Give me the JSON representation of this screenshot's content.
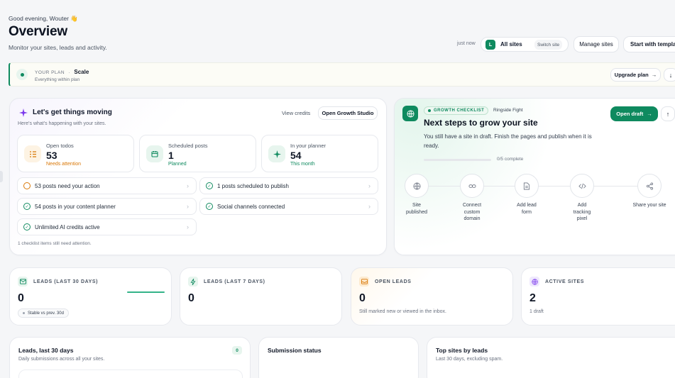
{
  "header": {
    "greeting": "Good evening, Wouter 👋",
    "title": "Overview",
    "subtitle": "Monitor your sites, leads and activity.",
    "updated": "just now",
    "site_avatar": "L",
    "site_label": "All sites",
    "switch_site": "Switch site",
    "manage_sites": "Manage sites",
    "start_template": "Start with template"
  },
  "plan": {
    "label": "YOUR PLAN",
    "separator": "·",
    "name": "Scale",
    "desc": "Everything within plan",
    "upgrade": "Upgrade plan",
    "upgrade_arrow": "→",
    "download_arrow": "↓"
  },
  "moving": {
    "title": "Let's get things moving",
    "subtitle": "Here's what's happening with your sites.",
    "view_credits": "View credits",
    "open_studio": "Open Growth Studio",
    "stats": [
      {
        "label": "Open todos",
        "value": "53",
        "sub": "Needs attention",
        "sub_color": "#d97706"
      },
      {
        "label": "Scheduled posts",
        "value": "1",
        "sub": "Planned",
        "sub_color": "#0f8a5f"
      },
      {
        "label": "In your planner",
        "value": "54",
        "sub": "This month",
        "sub_color": "#0f8a5f"
      }
    ],
    "items": [
      {
        "text": "53 posts need your action",
        "state": "warn"
      },
      {
        "text": "1 posts scheduled to publish",
        "state": "ok"
      },
      {
        "text": "54 posts in your content planner",
        "state": "ok"
      },
      {
        "text": "Social channels connected",
        "state": "ok"
      },
      {
        "text": "Unlimited AI credits active",
        "state": "ok"
      }
    ],
    "footnote": "1 checklist items still need attention.",
    "chevron": "›"
  },
  "growth": {
    "badge": "GROWTH CHECKLIST",
    "site_name": "Ringside Fight",
    "title": "Next steps to grow your site",
    "desc": "You still have a site in draft. Finish the pages and publish when it is ready.",
    "progress_text": "0/5 complete",
    "progress": 0,
    "open_draft": "Open draft",
    "open_arrow": "→",
    "up_arrow": "↑",
    "steps": [
      {
        "label": "Site published",
        "icon": "globe-icon"
      },
      {
        "label": "Connect custom domain",
        "icon": "link-icon"
      },
      {
        "label": "Add lead form",
        "icon": "document-icon"
      },
      {
        "label": "Add tracking pixel",
        "icon": "code-icon"
      },
      {
        "label": "Share your site",
        "icon": "share-icon"
      }
    ]
  },
  "kpis": [
    {
      "label": "LEADS (LAST 30 DAYS)",
      "value": "0",
      "badge": "Stable vs prev. 30d",
      "color": "#0f8a5f"
    },
    {
      "label": "LEADS (LAST 7 DAYS)",
      "value": "0",
      "color": "#0f8a5f"
    },
    {
      "label": "OPEN LEADS",
      "value": "0",
      "sub": "Still marked new or viewed in the inbox.",
      "color": "#d97706"
    },
    {
      "label": "ACTIVE SITES",
      "value": "2",
      "sub": "1 draft",
      "color": "#7c3aed"
    }
  ],
  "bottom": {
    "leads_title": "Leads, last 30 days",
    "leads_sub": "Daily submissions across all your sites.",
    "leads_count": "0",
    "submission_title": "Submission status",
    "top_sites_title": "Top sites by leads",
    "top_sites_sub": "Last 30 days, excluding spam."
  },
  "colors": {
    "accent": "#0f8a5f",
    "warn": "#d97706",
    "purple": "#7c3aed"
  }
}
